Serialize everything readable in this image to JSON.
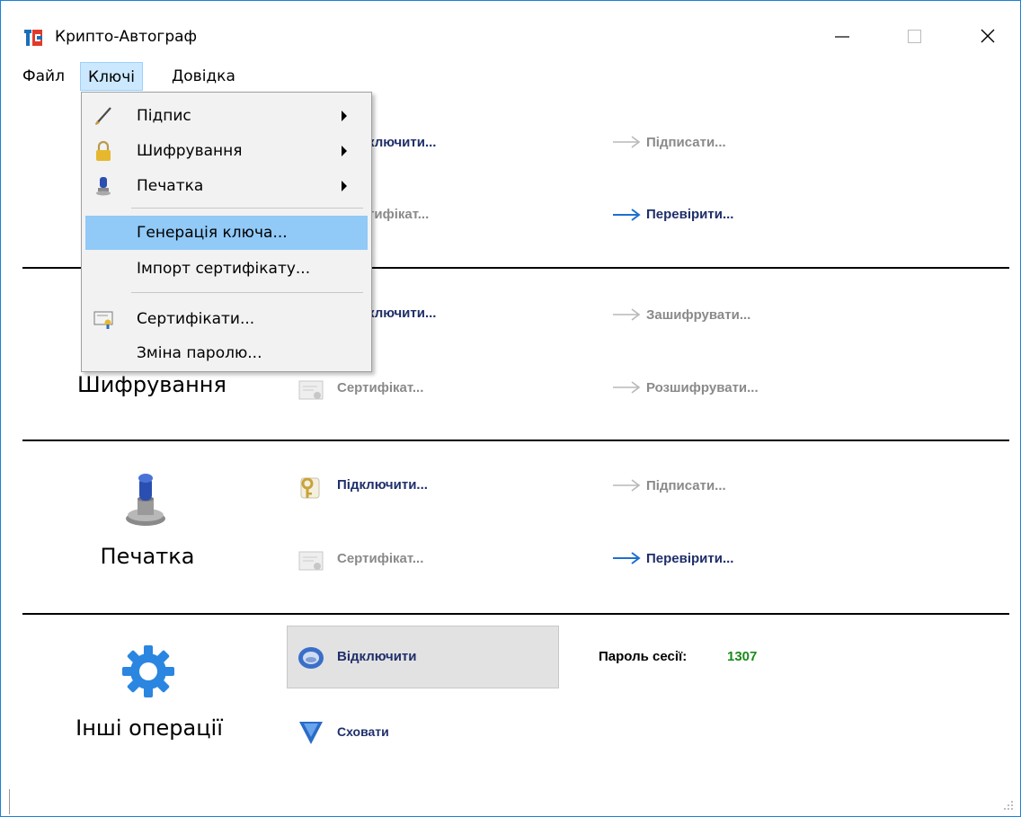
{
  "window": {
    "title": "Крипто-Автограф",
    "accent": "#1883d7"
  },
  "menubar": {
    "items": [
      "Файл",
      "Ключі",
      "Довідка"
    ]
  },
  "dropdown": {
    "items": [
      {
        "label": "Підпис",
        "icon": "pen-icon",
        "submenu": true
      },
      {
        "label": "Шифрування",
        "icon": "lock-icon",
        "submenu": true
      },
      {
        "label": "Печатка",
        "icon": "stamp-icon",
        "submenu": true
      },
      {
        "label": "Генерація ключа...",
        "highlighted": true
      },
      {
        "label": "Імпорт сертифікату..."
      },
      {
        "label": "Сертифікати...",
        "icon": "certificate-icon"
      },
      {
        "label": "Зміна паролю..."
      }
    ]
  },
  "sections": {
    "signature": {
      "connect": "ключити...",
      "certificate": "тифікат...",
      "sign": "Підписати...",
      "verify": "Перевірити..."
    },
    "encryption": {
      "title": "Шифрування",
      "connect": "ключити...",
      "certificate": "Сертифікат...",
      "encrypt": "Зашифрувати...",
      "decrypt": "Розшифрувати..."
    },
    "seal": {
      "title": "Печатка",
      "connect": "Підключити...",
      "certificate": "Сертифікат...",
      "sign": "Підписати...",
      "verify": "Перевірити..."
    },
    "other": {
      "title": "Інші операції",
      "disconnect": "Відключити",
      "hide": "Сховати",
      "session_label": "Пароль сесії:",
      "session_value": "1307"
    }
  },
  "colors": {
    "link_active": "#1f2f6a",
    "link_disabled": "#8a8a8a",
    "arrow_active": "#1e6fd0",
    "arrow_disabled": "#b8b8b8",
    "session": "#1a8a1a",
    "menu_highlight": "#91c9f7"
  }
}
